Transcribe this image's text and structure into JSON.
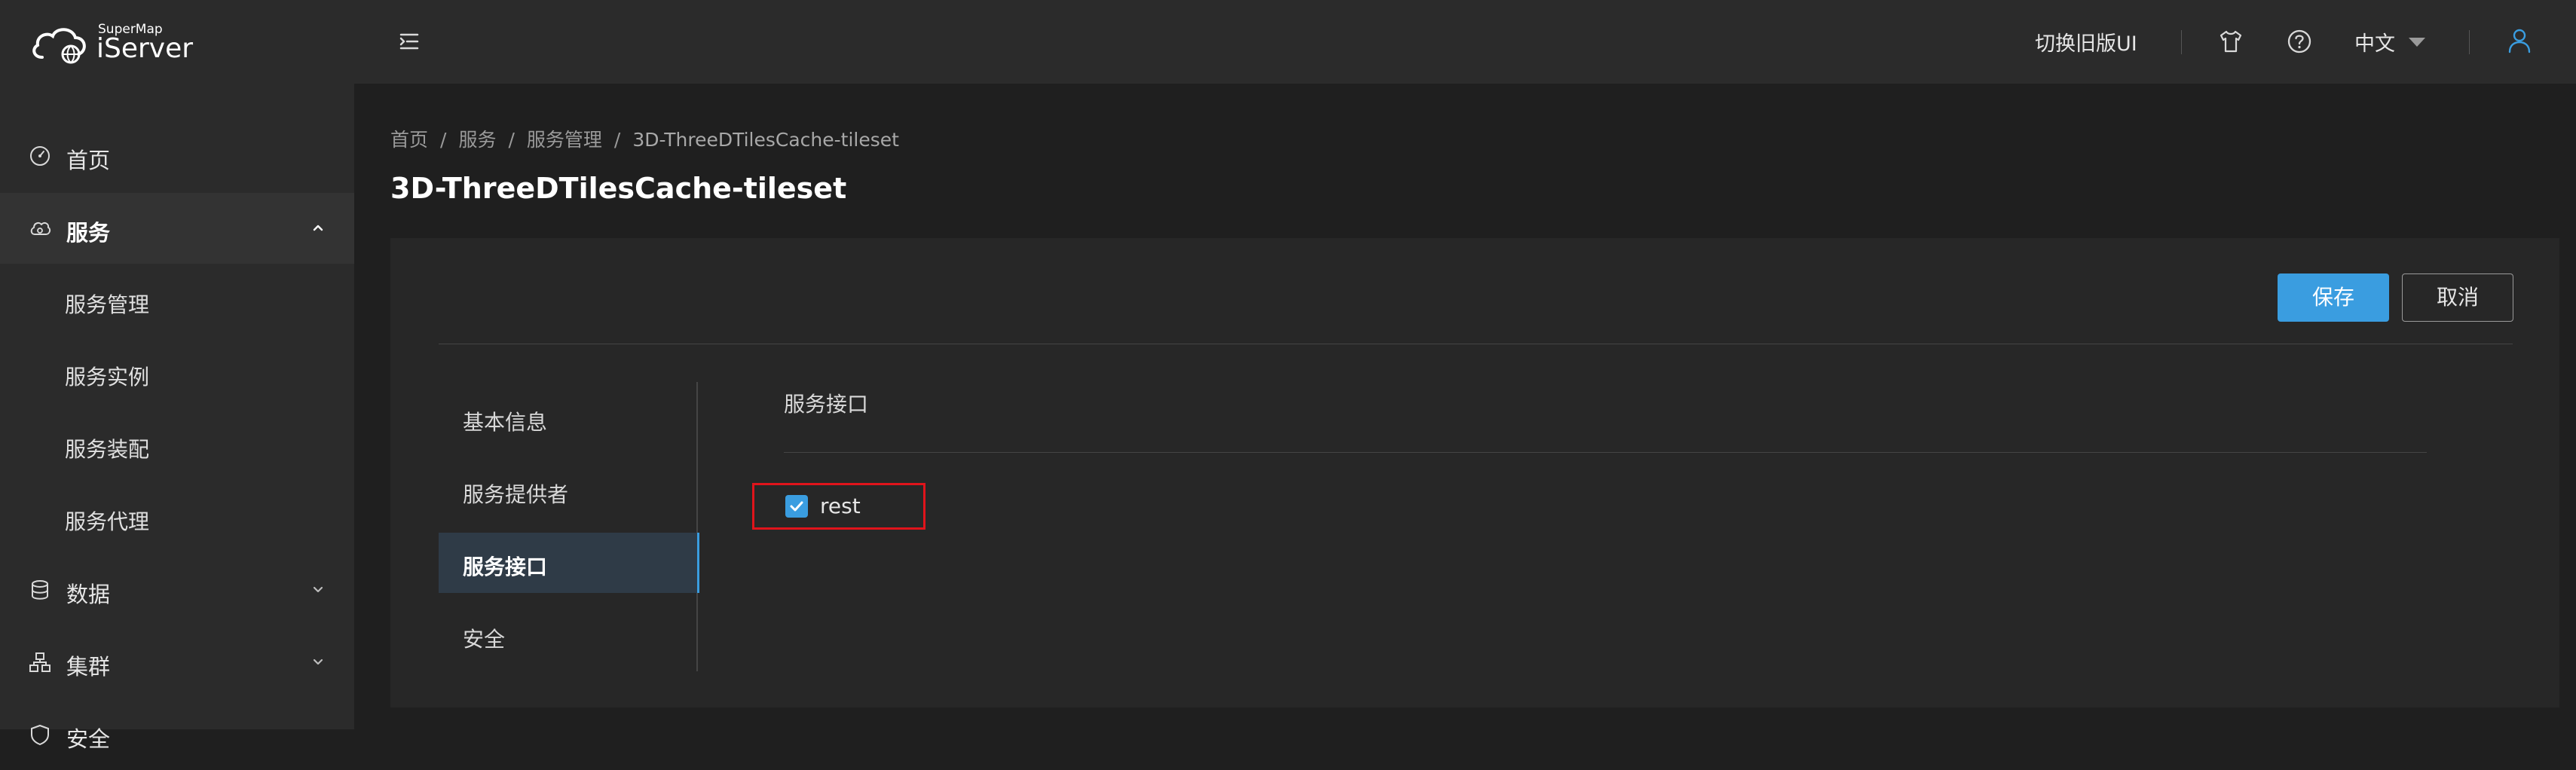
{
  "brand": {
    "small": "SuperMap",
    "big": "iServer"
  },
  "header": {
    "old_ui": "切换旧版UI",
    "language": "中文",
    "icons": [
      "menu-toggle-icon",
      "tshirt-icon",
      "help-icon",
      "user-icon"
    ]
  },
  "sidebar": {
    "items": [
      {
        "label": "首页",
        "icon": "dashboard-icon"
      },
      {
        "label": "服务",
        "icon": "service-icon",
        "expanded": true,
        "active": true
      },
      {
        "label": "数据",
        "icon": "database-icon"
      },
      {
        "label": "集群",
        "icon": "cluster-icon"
      },
      {
        "label": "安全",
        "icon": "shield-icon"
      }
    ],
    "sub_items": [
      "服务管理",
      "服务实例",
      "服务装配",
      "服务代理"
    ]
  },
  "breadcrumb": [
    "首页",
    "服务",
    "服务管理",
    "3D-ThreeDTilesCache-tileset"
  ],
  "page_title": "3D-ThreeDTilesCache-tileset",
  "actions": {
    "save": "保存",
    "cancel": "取消"
  },
  "tabs": [
    {
      "label": "基本信息"
    },
    {
      "label": "服务提供者"
    },
    {
      "label": "服务接口",
      "active": true
    },
    {
      "label": "安全"
    }
  ],
  "section": {
    "title": "服务接口",
    "interfaces": [
      {
        "label": "rest",
        "checked": true
      }
    ]
  },
  "colors": {
    "accent": "#3a9de0",
    "highlight": "#e0141b",
    "bg": "#1f1f1f",
    "panel": "#272727"
  }
}
